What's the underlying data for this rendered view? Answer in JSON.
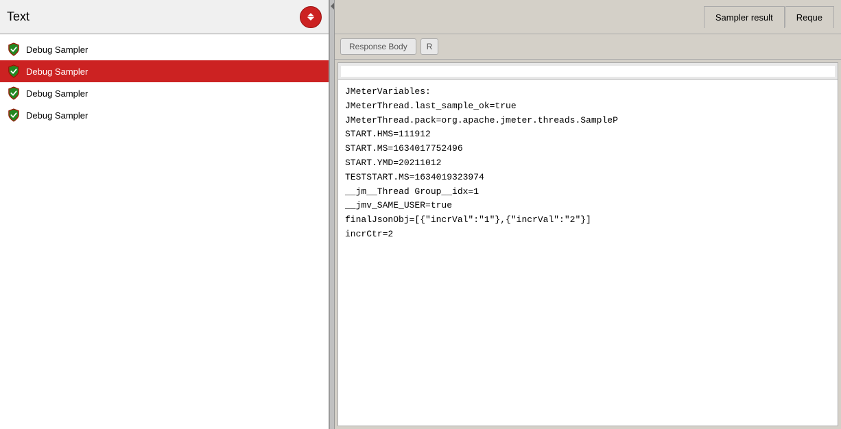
{
  "left_panel": {
    "header_title": "Text",
    "spinner_label": "spinner",
    "items": [
      {
        "label": "Debug Sampler",
        "selected": false,
        "id": "item-1"
      },
      {
        "label": "Debug Sampler",
        "selected": true,
        "id": "item-2"
      },
      {
        "label": "Debug Sampler",
        "selected": false,
        "id": "item-3"
      },
      {
        "label": "Debug Sampler",
        "selected": false,
        "id": "item-4"
      }
    ]
  },
  "right_panel": {
    "tabs": [
      {
        "label": "Sampler result",
        "active": true
      },
      {
        "label": "Reque",
        "active": false
      }
    ],
    "sub_tabs": [
      {
        "label": "Response Body"
      },
      {
        "label": "R"
      }
    ],
    "content_lines": [
      "JMeterVariables:",
      "JMeterThread.last_sample_ok=true",
      "JMeterThread.pack=org.apache.jmeter.threads.SampleP",
      "START.HMS=111912",
      "START.MS=1634017752496",
      "START.YMD=20211012",
      "TESTSTART.MS=1634019323974",
      "__jm__Thread Group__idx=1",
      "__jmv_SAME_USER=true",
      "finalJsonObj=[{\"incrVal\":\"1\"},{\"incrVal\":\"2\"}]",
      "incrCtr=2"
    ]
  }
}
